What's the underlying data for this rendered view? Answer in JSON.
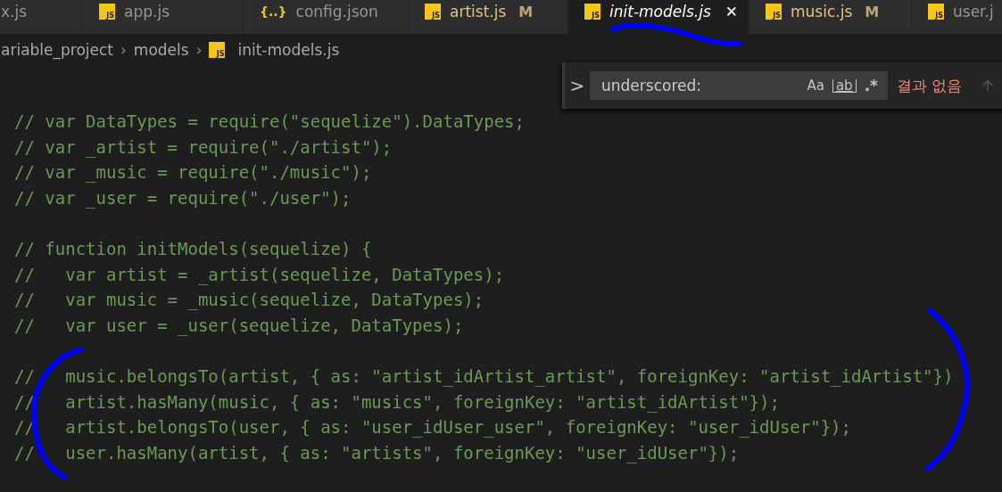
{
  "tabs": [
    {
      "label": "x.js",
      "selected": false,
      "italic": false
    },
    {
      "label": "app.js",
      "icon": "JS",
      "kind": "js",
      "selected": false,
      "italic": false
    },
    {
      "label": "config.json",
      "icon": "{..}",
      "kind": "json",
      "selected": false,
      "italic": false
    },
    {
      "label": "artist.js",
      "icon": "JS",
      "kind": "js",
      "modified": "M",
      "selected": false,
      "italic": false
    },
    {
      "label": "init-models.js",
      "icon": "JS",
      "kind": "js",
      "selected": true,
      "italic": true,
      "close": "✕"
    },
    {
      "label": "music.js",
      "icon": "JS",
      "kind": "js",
      "modified": "M",
      "selected": false,
      "italic": false
    },
    {
      "label": "user.j",
      "icon": "JS",
      "kind": "js",
      "selected": false,
      "italic": false
    }
  ],
  "breadcrumb": {
    "items": [
      {
        "label": "ariable_project",
        "separator": "›"
      },
      {
        "label": "models",
        "separator": "›"
      }
    ],
    "file_icon": "JS",
    "file": "init-models.js"
  },
  "find": {
    "chevron": ">",
    "value": "underscored:",
    "options": [
      {
        "label": "Aa",
        "kind": "case"
      },
      {
        "label": "ab",
        "kind": "word"
      },
      {
        "label": ".*",
        "kind": "regex"
      }
    ],
    "result": "결과 없음"
  },
  "code": [
    [
      "// var DataTypes = require(\"sequelize\").DataTypes;",
      "// var _artist = require(\"./artist\");",
      "// var _music = require(\"./music\");",
      "// var _user = require(\"./user\");"
    ],
    [
      "// function initModels(sequelize) {",
      "//   var artist = _artist(sequelize, DataTypes);",
      "//   var music = _music(sequelize, DataTypes);",
      "//   var user = _user(sequelize, DataTypes);"
    ],
    [
      "//   music.belongsTo(artist, { as: \"artist_idArtist_artist\", foreignKey: \"artist_idArtist\"})",
      "//   artist.hasMany(music, { as: \"musics\", foreignKey: \"artist_idArtist\"});",
      "//   artist.belongsTo(user, { as: \"user_idUser_user\", foreignKey: \"user_idUser\"});",
      "//   user.hasMany(artist, { as: \"artists\", foreignKey: \"user_idUser\"});"
    ]
  ]
}
